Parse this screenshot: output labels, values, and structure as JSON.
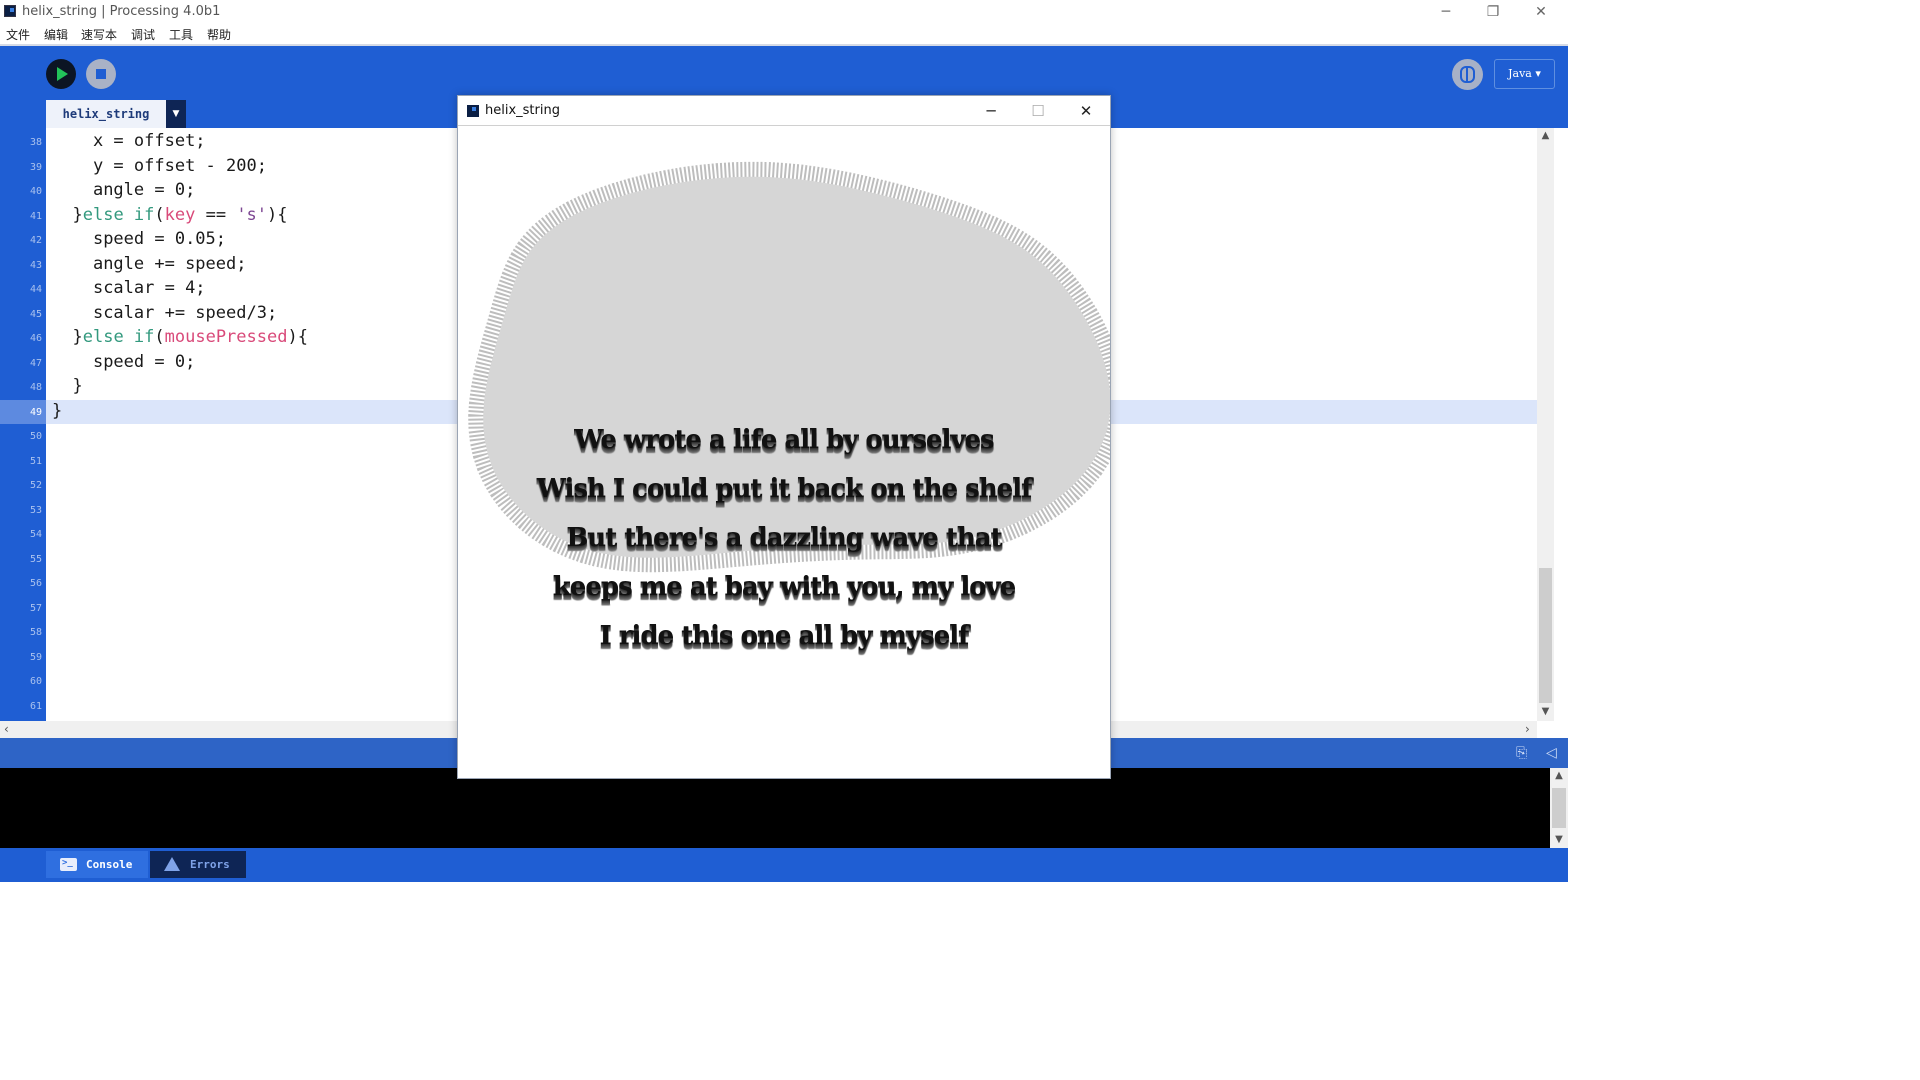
{
  "window": {
    "title": "helix_string | Processing 4.0b1",
    "controls": {
      "minimize": "─",
      "restore": "❐",
      "close": "✕"
    }
  },
  "menu": [
    "文件",
    "编辑",
    "速写本",
    "调试",
    "工具",
    "帮助"
  ],
  "toolbar": {
    "mode_label": "Java ▾"
  },
  "tabs": [
    {
      "label": "helix_string",
      "active": true
    }
  ],
  "tab_menu_glyph": "▼",
  "editor": {
    "line_numbers": [
      "38",
      "39",
      "40",
      "41",
      "42",
      "43",
      "44",
      "45",
      "46",
      "47",
      "48",
      "49",
      "50",
      "51",
      "52",
      "53",
      "54",
      "55",
      "56",
      "57",
      "58",
      "59",
      "60",
      "61"
    ],
    "current_line": "49",
    "code": [
      {
        "indent": "    ",
        "text": "x = offset;"
      },
      {
        "indent": "    ",
        "text": "y = offset - 200;"
      },
      {
        "indent": "    ",
        "text": "angle = 0;"
      },
      {
        "indent": "  ",
        "pre": "}",
        "kw": "else if",
        "mid": "(",
        "var": "key",
        "mid2": " == ",
        "str": "'s'",
        "post": "){"
      },
      {
        "indent": "    ",
        "text": "speed = 0.05;"
      },
      {
        "indent": "    ",
        "text": "angle += speed;"
      },
      {
        "indent": "    ",
        "text": "scalar = 4;"
      },
      {
        "indent": "    ",
        "text": "scalar += speed/3;"
      },
      {
        "indent": "  ",
        "pre": "}",
        "kw": "else if",
        "mid": "(",
        "var": "mousePressed",
        "post": "){"
      },
      {
        "indent": "    ",
        "text": "speed = 0;"
      },
      {
        "indent": "  ",
        "text": "}"
      },
      {
        "indent": "",
        "text": "}"
      }
    ]
  },
  "console_tabs": {
    "console": "Console",
    "errors": "Errors"
  },
  "sketch": {
    "title": "helix_string",
    "controls": {
      "minimize": "─",
      "maximize": "☐",
      "close": "✕"
    },
    "lyrics": [
      "We wrote a life all by ourselves",
      "Wish I could put it back on the shelf",
      "But there's a dazzling wave that",
      "keeps me at bay with you, my love",
      "I ride this one all by myself"
    ],
    "colors": {
      "blob": "#d6d6d6",
      "blob_edge": "#bdbdbd",
      "background": "#ffffff"
    }
  }
}
